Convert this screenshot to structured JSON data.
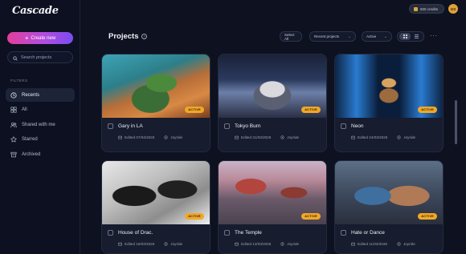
{
  "brand": {
    "logo_text": "Cascade"
  },
  "sidebar": {
    "create_label": "Create new",
    "search_placeholder": "Search projects",
    "filters_label": "FILTERS",
    "items": [
      {
        "label": "Recents",
        "icon": "clock-icon",
        "active": true
      },
      {
        "label": "All",
        "icon": "grid-icon",
        "active": false
      },
      {
        "label": "Shared with me",
        "icon": "users-icon",
        "active": false
      },
      {
        "label": "Starred",
        "icon": "star-icon",
        "active": false
      },
      {
        "label": "Archived",
        "icon": "archive-icon",
        "active": false
      }
    ]
  },
  "topbar": {
    "credits_label": "500 credits",
    "avatar_initials": "GS"
  },
  "header": {
    "title": "Projects",
    "select_all_label": "Select All",
    "sort_value": "Recent projects",
    "status_value": "Active",
    "more_label": "···"
  },
  "projects": [
    {
      "title": "Gary in LA",
      "edited": "Edited 07/04/2026",
      "workspace": "Joyride",
      "badge": "ACTIVE"
    },
    {
      "title": "Tokyo Burn",
      "edited": "Edited 31/03/2026",
      "workspace": "Joyride",
      "badge": "ACTIVE"
    },
    {
      "title": "Neon",
      "edited": "Edited 24/03/2026",
      "workspace": "Joyride",
      "badge": "ACTIVE"
    },
    {
      "title": "House of Drac.",
      "edited": "Edited 16/03/2026",
      "workspace": "Joyride",
      "badge": "ACTIVE"
    },
    {
      "title": "The Temple",
      "edited": "Edited 13/03/2026",
      "workspace": "Joyride",
      "badge": "ACTIVE"
    },
    {
      "title": "Hate or Dance",
      "edited": "Edited 11/03/2026",
      "workspace": "Joyride",
      "badge": "ACTIVE"
    }
  ],
  "colors": {
    "background": "#0e1220",
    "accent_gradient_start": "#e23f9a",
    "accent_gradient_end": "#7a4cf0",
    "badge": "#f0a828"
  }
}
